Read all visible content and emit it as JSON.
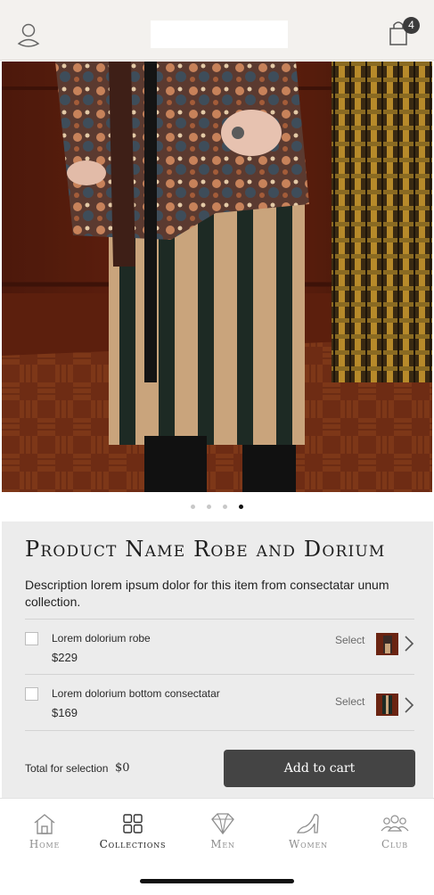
{
  "header": {
    "account_icon": "user-icon",
    "cart_icon": "shopping-bag-icon",
    "cart_count": "4"
  },
  "carousel": {
    "slide_count": 4,
    "active_index": 3
  },
  "product": {
    "title": "Product Name Robe and Dorium",
    "description": "Description lorem ipsum dolor for this item from consectatar unum collection.",
    "items": [
      {
        "name": "Lorem dolorium robe",
        "price": "$229",
        "select_label": "Select"
      },
      {
        "name": "Lorem dolorium bottom consectatar",
        "price": "$169",
        "select_label": "Select"
      }
    ],
    "total_label": "Total for selection",
    "total_value": "$0",
    "add_to_cart_label": "Add to cart"
  },
  "bottom_nav": {
    "items": [
      {
        "label": "Home",
        "icon": "home-icon"
      },
      {
        "label": "Collections",
        "icon": "grid-icon"
      },
      {
        "label": "Men",
        "icon": "diamond-icon"
      },
      {
        "label": "Women",
        "icon": "heel-shoe-icon"
      },
      {
        "label": "Club",
        "icon": "group-icon"
      }
    ],
    "active_index": 1
  },
  "colors": {
    "header_bg": "#f3f1ee",
    "panel_bg": "#ececec",
    "button_bg": "#444444",
    "active_dot": "#111111"
  }
}
